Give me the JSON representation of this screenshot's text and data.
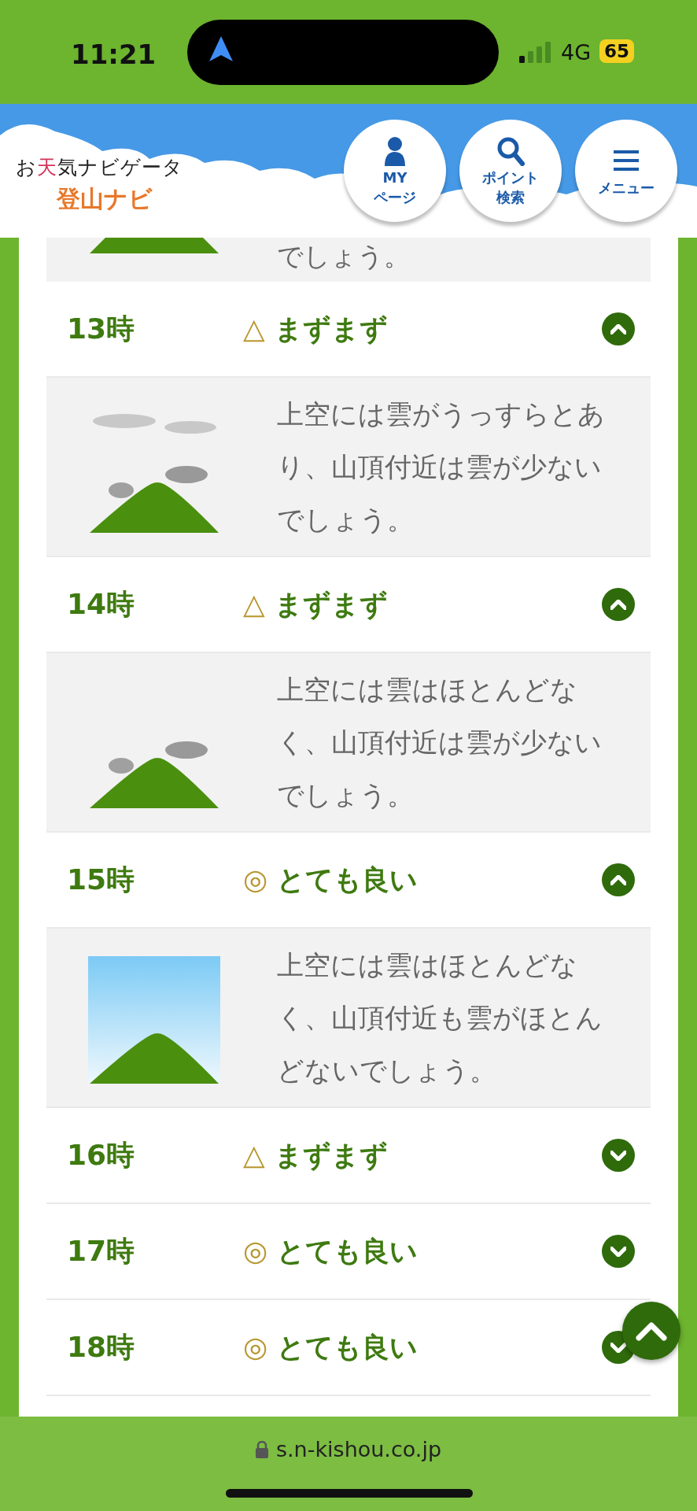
{
  "status_bar": {
    "time": "11:21",
    "network": "4G",
    "battery": "65"
  },
  "header": {
    "logo_top": "お天気ナビゲータ",
    "logo_bottom": "登山ナビ",
    "buttons": [
      {
        "kind": "person",
        "label_lines": [
          "MY",
          "ページ"
        ]
      },
      {
        "kind": "search",
        "label_lines": [
          "ポイント",
          "検索"
        ]
      },
      {
        "kind": "menu",
        "label_lines": [
          "メニュー"
        ]
      }
    ]
  },
  "partial_detail": {
    "text": "でしょう。"
  },
  "forecast_rows": [
    {
      "time": "13時",
      "symbol": "△",
      "rating": "まずまず",
      "expanded": true,
      "detail": {
        "kind": "clouds_high_low",
        "text": "上空には雲がうっすらとあり、山頂付近は雲が少ないでしょう。"
      }
    },
    {
      "time": "14時",
      "symbol": "△",
      "rating": "まずまず",
      "expanded": true,
      "detail": {
        "kind": "clouds_low",
        "text": "上空には雲はほとんどなく、山頂付近は雲が少ないでしょう。"
      }
    },
    {
      "time": "15時",
      "symbol": "◎",
      "rating": "とても良い",
      "expanded": true,
      "detail": {
        "kind": "clear",
        "text": "上空には雲はほとんどなく、山頂付近も雲がほとんどないでしょう。"
      }
    },
    {
      "time": "16時",
      "symbol": "△",
      "rating": "まずまず",
      "expanded": false
    },
    {
      "time": "17時",
      "symbol": "◎",
      "rating": "とても良い",
      "expanded": false
    },
    {
      "time": "18時",
      "symbol": "◎",
      "rating": "とても良い",
      "expanded": false
    }
  ],
  "address_bar": {
    "url": "s.n-kishou.co.jp"
  }
}
